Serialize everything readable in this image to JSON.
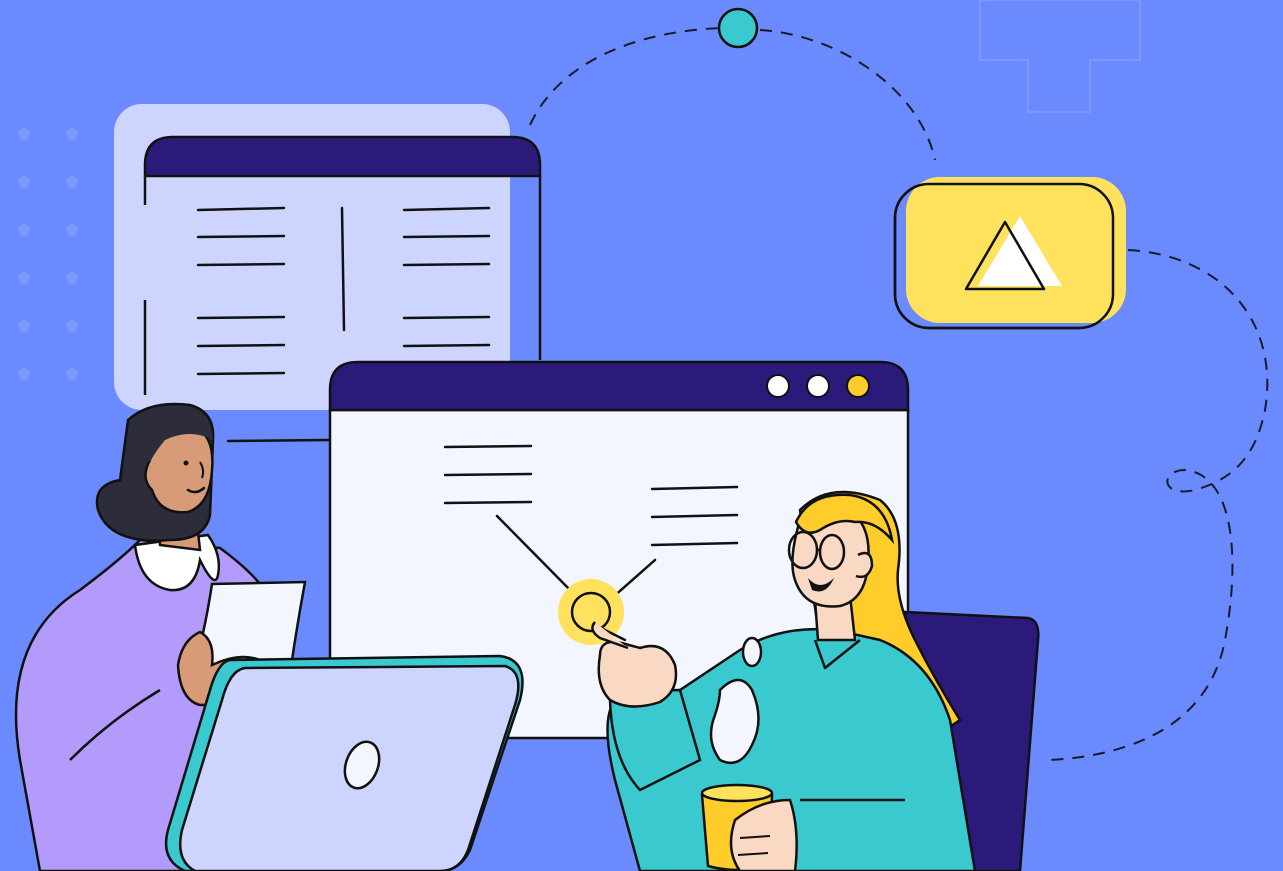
{
  "colors": {
    "background": "#6b8afd",
    "window_header": "#2b1a7a",
    "window_body_back": "#cdd5fe",
    "window_body_front": "#f4f6ff",
    "accent_yellow": "#fee25e",
    "accent_teal": "#3ac9cf",
    "outline": "#111111",
    "shirt_purple": "#b39bfb",
    "skin_tan": "#d79c77",
    "skin_light": "#f9d8c4",
    "hair_dark": "#2c2c3a",
    "hair_blonde": "#fecc2b"
  },
  "icons": {
    "alert_badge": "warning-triangle-icon",
    "laptop_logo": "laptop-logo-icon",
    "window_buttons": "window-control-dots-icon",
    "connector_node": "circle-node-icon"
  },
  "scene": {
    "people": [
      "woman-with-paper-and-laptop",
      "woman-with-glasses-and-coffee-mug"
    ],
    "windows": [
      "back-window-two-column-text",
      "front-window-with-controls"
    ]
  }
}
